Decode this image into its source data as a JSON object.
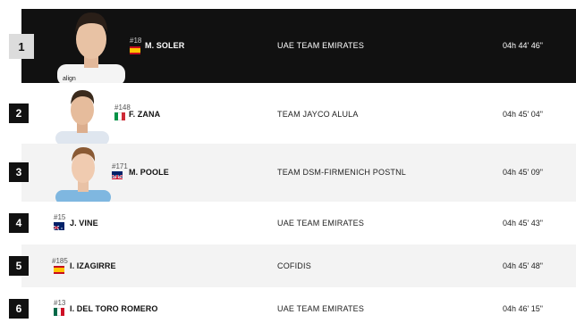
{
  "riders": [
    {
      "position": "1",
      "bib": "#18",
      "name": "M. SOLER",
      "team": "UAE TEAM EMIRATES",
      "time": "04h 44' 46\"",
      "flag": "spain-flag"
    },
    {
      "position": "2",
      "bib": "#148",
      "name": "F. ZANA",
      "team": "TEAM JAYCO ALULA",
      "time": "04h 45' 04\"",
      "flag": "italy-flag"
    },
    {
      "position": "3",
      "bib": "#171",
      "name": "M. POOLE",
      "team": "TEAM DSM-FIRMENICH POSTNL",
      "time": "04h 45' 09\"",
      "flag": "uk-flag"
    },
    {
      "position": "4",
      "bib": "#15",
      "name": "J. VINE",
      "team": "UAE TEAM EMIRATES",
      "time": "04h 45' 43\"",
      "flag": "australia-flag"
    },
    {
      "position": "5",
      "bib": "#185",
      "name": "I. IZAGIRRE",
      "team": "COFIDIS",
      "time": "04h 45' 48\"",
      "flag": "spain-flag"
    },
    {
      "position": "6",
      "bib": "#13",
      "name": "I. DEL TORO ROMERO",
      "team": "UAE TEAM EMIRATES",
      "time": "04h 46' 15\"",
      "flag": "mexico-flag"
    }
  ],
  "colors": {
    "winner_bg": "#111111",
    "alt_bg": "#f3f3f3",
    "rank_bg": "#111111"
  }
}
